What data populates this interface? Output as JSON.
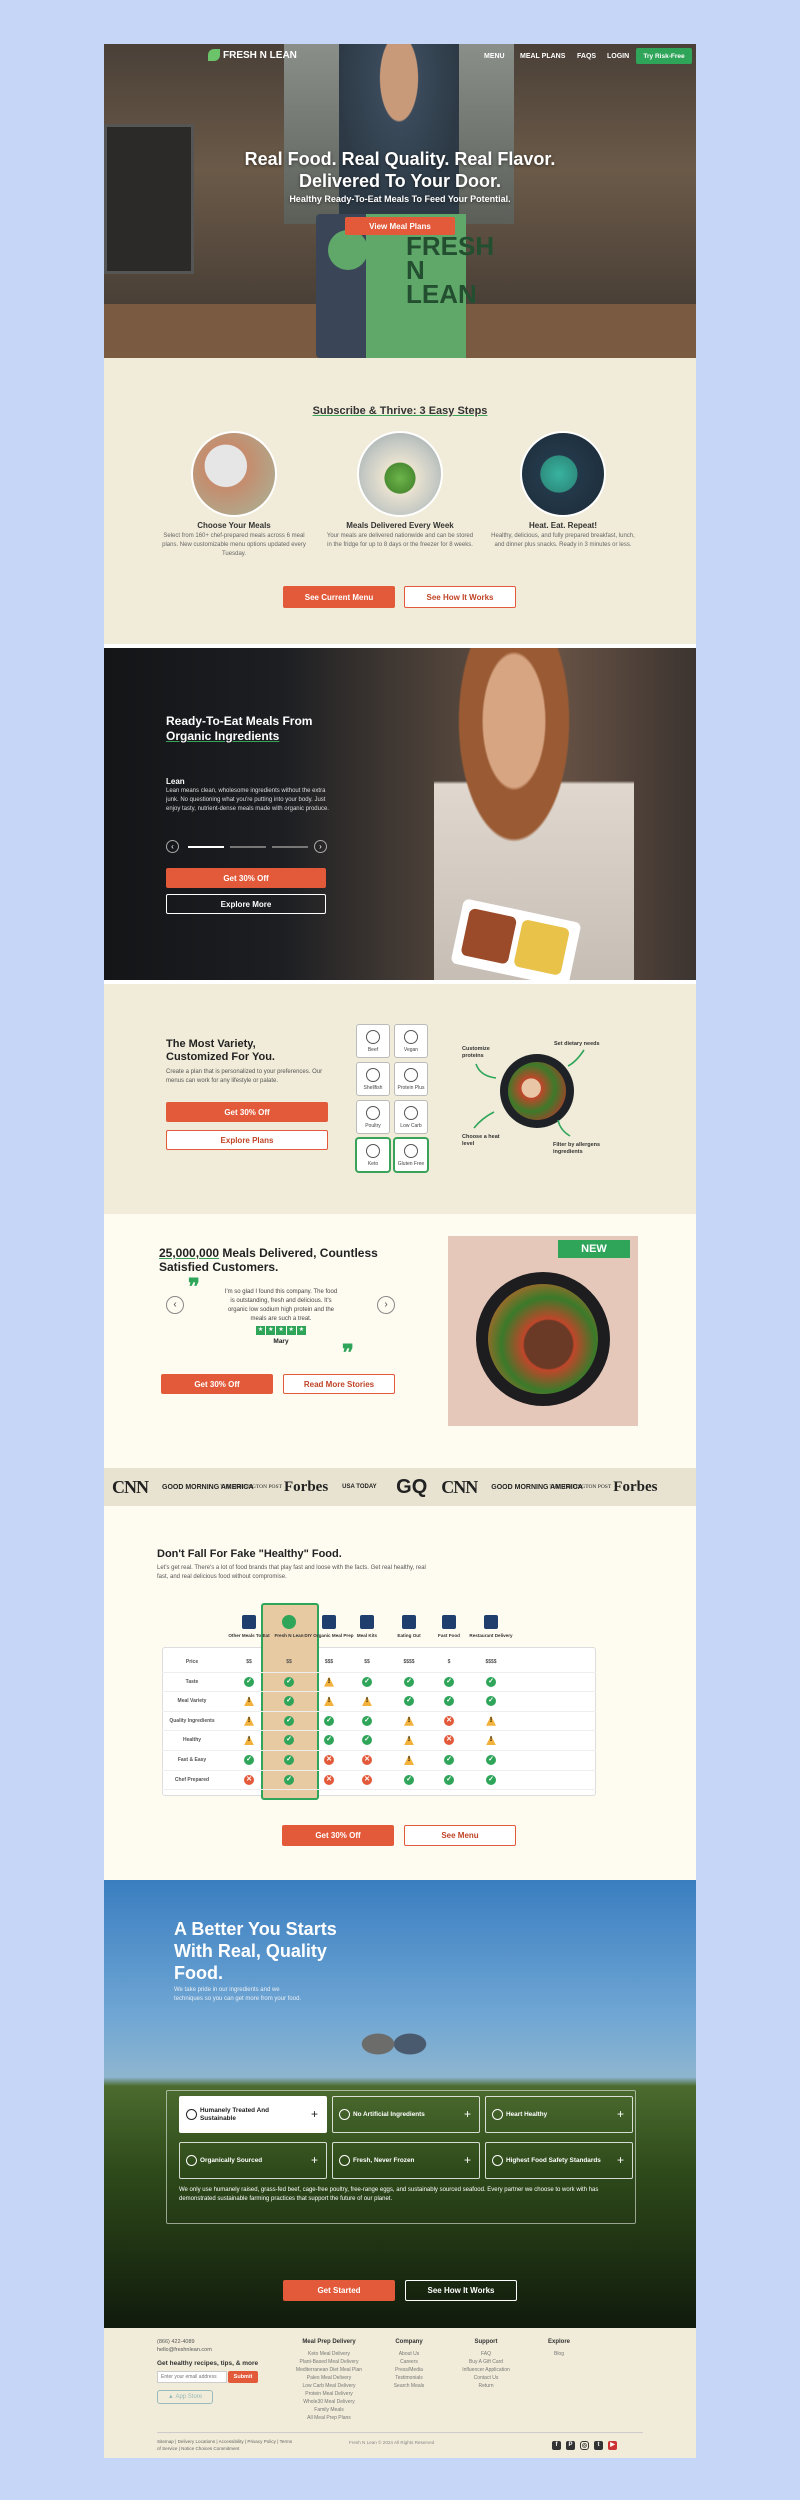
{
  "nav": {
    "logo": "FRESH N LEAN",
    "links": [
      "MENU",
      "MEAL PLANS",
      "FAQS",
      "LOGIN"
    ],
    "cta": "Try Risk-Free"
  },
  "hero": {
    "headline_line1": "Real Food. Real Quality. Real Flavor.",
    "headline_line2": "Delivered To Your Door.",
    "subheadline": "Healthy Ready-To-Eat Meals To Feed Your Potential.",
    "cta": "View Meal Plans",
    "box_logo_line1": "FRESH",
    "box_logo_line2": "N LEAN"
  },
  "steps": {
    "title": "Subscribe & Thrive: 3 Easy Steps",
    "items": [
      {
        "title": "Choose Your Meals",
        "text": "Select from 160+ chef-prepared meals across 6 meal plans. New customizable menu options updated every Tuesday."
      },
      {
        "title": "Meals Delivered Every Week",
        "text": "Your meals are delivered nationwide and can be stored in the fridge for up to 8 days or the freezer for 8 weeks."
      },
      {
        "title": "Heat. Eat. Repeat!",
        "text": "Healthy, delicious, and fully prepared breakfast, lunch, and dinner plus snacks. Ready in 3 minutes or less."
      }
    ],
    "cta_primary": "See Current Menu",
    "cta_secondary": "See How It Works"
  },
  "lean": {
    "title_line1": "Ready-To-Eat Meals From",
    "title_line2": "Organic Ingredients",
    "plan_name": "Lean",
    "plan_text": "Lean means clean, wholesome ingredients without the extra junk. No questioning what you're putting into your body. Just enjoy tasty, nutrient-dense meals made with organic produce.",
    "cta_primary": "Get 30% Off",
    "cta_secondary": "Explore More"
  },
  "variety": {
    "title_line1": "The Most Variety,",
    "title_line2": "Customized For You.",
    "text": "Create a plan that is personalized to your preferences. Our menus can work for any lifestyle or palate.",
    "cta_primary": "Get 30% Off",
    "cta_secondary": "Explore Plans",
    "diets": [
      "Beef",
      "Vegan",
      "Shellfish",
      "Protein Plus",
      "Poultry",
      "Low Carb",
      "Keto",
      "Gluten Free"
    ],
    "callouts": [
      "Customize proteins",
      "Set dietary needs",
      "Choose a heat level",
      "Filter by allergens ingredients"
    ]
  },
  "testimonials": {
    "count": "25,000,000",
    "title_rest": "Meals Delivered, Countless",
    "title_line2": "Satisfied Customers.",
    "quote": "I'm so glad I found this company. The food is outstanding, fresh and delicious. It's organic low sodium high protein and the meals are such a treat.",
    "author": "Mary",
    "rating": 5,
    "badge": "NEW",
    "cta_primary": "Get 30% Off",
    "cta_secondary": "Read More Stories"
  },
  "press": {
    "logos": [
      "CNN",
      "GOOD MORNING AMERICA",
      "THE HUFFINGTON POST",
      "Forbes",
      "USA TODAY",
      "GQ",
      "CNN",
      "GOOD MORNING AMERICA",
      "THE HUFFINGTON POST",
      "Forbes"
    ]
  },
  "compare": {
    "title": "Don't Fall For Fake \"Healthy\" Food.",
    "subtitle": "Let's get real. There's a lot of food brands that play fast and loose with the facts. Get real healthy, real fast, and real delicious food without compromise.",
    "columns": [
      "Other Meals To Eat",
      "Fresh N Lean",
      "DIY Organic Meal Prep",
      "Meal Kits",
      "Eating Out",
      "Fast Food",
      "Restaurant Delivery"
    ],
    "rows": [
      {
        "label": "Price",
        "cells": [
          "$$",
          "$$",
          "$$$",
          "$$",
          "$$$$",
          "$",
          "$$$$"
        ]
      },
      {
        "label": "Taste",
        "cells": [
          "y",
          "y",
          "w",
          "y",
          "y",
          "y",
          "y"
        ]
      },
      {
        "label": "Meal Variety",
        "cells": [
          "w",
          "y",
          "w",
          "w",
          "y",
          "y",
          "y"
        ]
      },
      {
        "label": "Quality Ingredients",
        "cells": [
          "w",
          "y",
          "y",
          "y",
          "w",
          "n",
          "w"
        ]
      },
      {
        "label": "Healthy",
        "cells": [
          "w",
          "y",
          "y",
          "y",
          "w",
          "n",
          "w"
        ]
      },
      {
        "label": "Fast & Easy",
        "cells": [
          "y",
          "y",
          "n",
          "n",
          "w",
          "y",
          "y"
        ]
      },
      {
        "label": "Chef Prepared",
        "cells": [
          "n",
          "y",
          "n",
          "n",
          "y",
          "y",
          "y"
        ]
      }
    ],
    "cta_primary": "Get 30% Off",
    "cta_secondary": "See Menu"
  },
  "better": {
    "title_line1": "A Better You Starts",
    "title_line2": "With Real, Quality",
    "title_line3": "Food.",
    "text": "We take pride in our ingredients and we techniques so you can get more from your food.",
    "features": [
      "Humanely Treated And Sustainable",
      "No Artificial Ingredients",
      "Heart Healthy",
      "Organically Sourced",
      "Fresh, Never Frozen",
      "Highest Food Safety Standards"
    ],
    "detail": "We only use humanely raised, grass-fed beef, cage-free poultry, free-range eggs, and sustainably sourced seafood. Every partner we choose to work with has demonstrated sustainable farming practices that support the future of our planet.",
    "cta_primary": "Get Started",
    "cta_secondary": "See How It Works"
  },
  "footer": {
    "phone": "(866) 422-4089",
    "email": "hello@freshnlean.com",
    "newsletter_title": "Get healthy recipes, tips, & more",
    "email_placeholder": "Enter your email address",
    "submit": "Submit",
    "app_store": "App Store",
    "columns": [
      {
        "title": "Meal Prep Delivery",
        "links": [
          "Keto Meal Delivery",
          "Plant-Based Meal Delivery",
          "Mediterranean Diet Meal Plan",
          "Paleo Meal Delivery",
          "Low Carb Meal Delivery",
          "Protein Meal Delivery",
          "Whole30 Meal Delivery",
          "Family Meals",
          "All Meal Prep Plans"
        ]
      },
      {
        "title": "Company",
        "links": [
          "About Us",
          "Careers",
          "Press/Media",
          "Testimonials",
          "Search Meals"
        ]
      },
      {
        "title": "Support",
        "links": [
          "FAQ",
          "Buy A Gift Card",
          "Influencer Application",
          "Contact Us",
          "Return"
        ]
      },
      {
        "title": "Explore",
        "links": [
          "Blog"
        ]
      }
    ],
    "legal": "Sitemap | Delivery Locations | Accessibility | Privacy Policy | Terms of Service | Notice Choices Commitment",
    "copyright": "Fresh N Lean © 2024 All Rights Reserved"
  },
  "colors": {
    "accent": "#e25a3a",
    "green": "#3aa35a",
    "cream": "#f1ecd9"
  }
}
